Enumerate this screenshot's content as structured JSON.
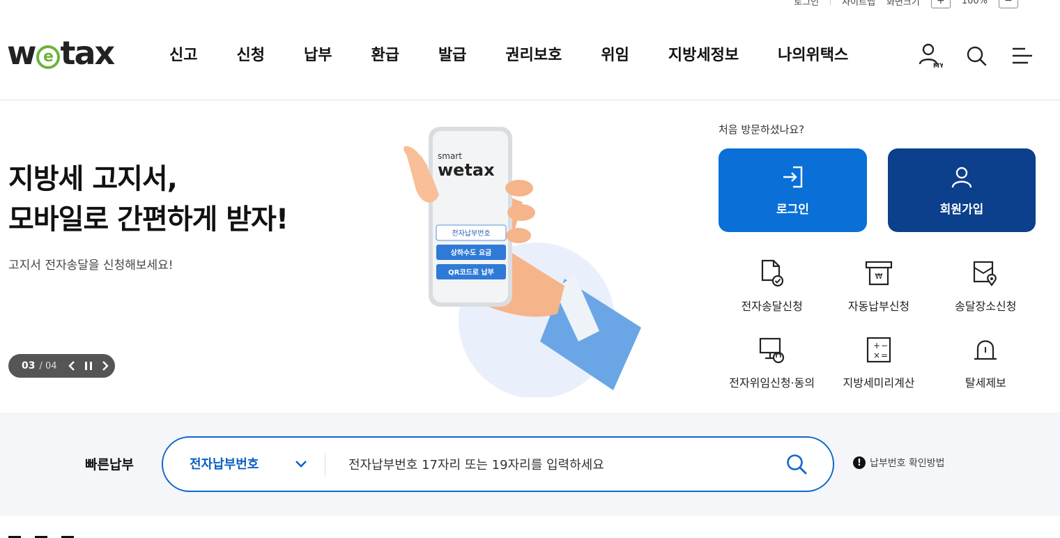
{
  "header": {
    "logo": "wetax",
    "nav": [
      "신고",
      "신청",
      "납부",
      "환급",
      "발급",
      "권리보호",
      "위임",
      "지방세정보",
      "나의위택스"
    ],
    "util": {
      "zoom": "100%"
    }
  },
  "hero": {
    "title": "지방세 고지서,\n모바일로 간편하게 받자!",
    "subtitle": "고지서 전자송달을 신청해보세요!",
    "pager": {
      "current": "03",
      "total": "/ 04"
    },
    "phone": {
      "brand_small": "smart",
      "brand": "wetax",
      "buttons": [
        "전자납부번호",
        "상하수도 요금",
        "QR코드로 납부"
      ]
    }
  },
  "panel": {
    "first_visit": "처음 방문하셨나요?",
    "login": "로그인",
    "join": "회원가입",
    "quick_menu": [
      {
        "label": "전자송달신청",
        "icon": "document-check-icon"
      },
      {
        "label": "자동납부신청",
        "icon": "auto-pay-icon"
      },
      {
        "label": "송달장소신청",
        "icon": "location-document-icon"
      },
      {
        "label": "전자위임신청·동의",
        "icon": "monitor-lock-icon"
      },
      {
        "label": "지방세미리계산",
        "icon": "calculator-icon"
      },
      {
        "label": "탈세제보",
        "icon": "alarm-bell-icon"
      }
    ]
  },
  "quick_pay": {
    "label": "빠른납부",
    "select": "전자납부번호",
    "placeholder": "전자납부번호 17자리 또는 19자리를 입력하세요",
    "help": "납부번호 확인방법"
  },
  "colors": {
    "login_bg": "#0a6fd6",
    "join_bg": "#0c3f8c",
    "accent": "#1366c8",
    "logo_green": "#6cb33e"
  }
}
